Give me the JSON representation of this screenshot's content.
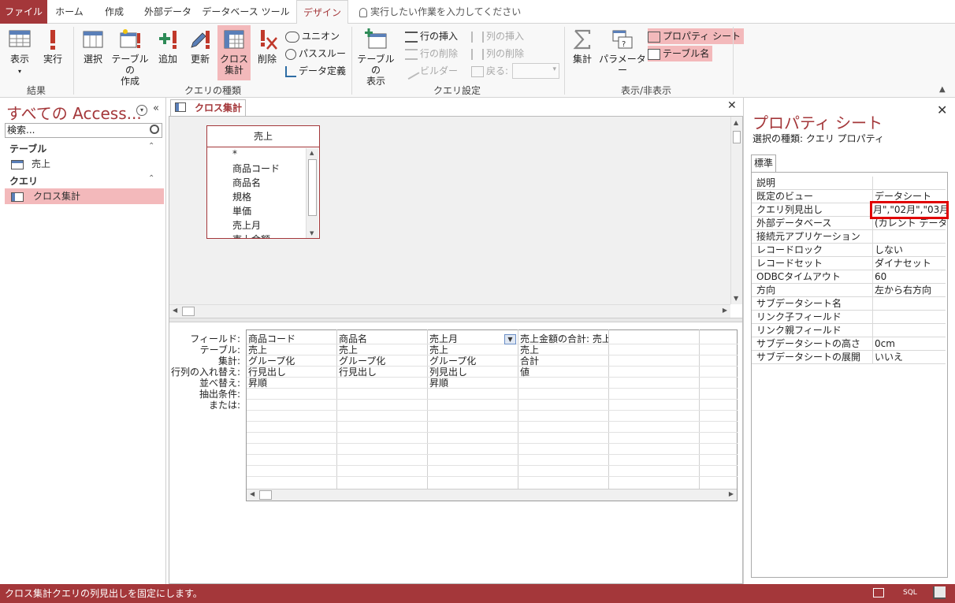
{
  "tabs": {
    "file": "ファイル",
    "home": "ホーム",
    "create": "作成",
    "external": "外部データ",
    "dbtools": "データベース ツール",
    "design": "デザイン",
    "tellme": "実行したい作業を入力してください"
  },
  "ribbon": {
    "results": {
      "label": "結果",
      "view": "表示",
      "run": "実行"
    },
    "querytype": {
      "label": "クエリの種類",
      "select": "選択",
      "maketable_1": "テーブルの",
      "maketable_2": "作成",
      "append": "追加",
      "update": "更新",
      "crosstab_1": "クロス",
      "crosstab_2": "集計",
      "delete": "削除",
      "union": "ユニオン",
      "passthrough": "パススルー",
      "datadef": "データ定義"
    },
    "setup": {
      "label": "クエリ設定",
      "showtable_1": "テーブルの",
      "showtable_2": "表示",
      "insert_rows": "行の挿入",
      "delete_rows": "行の削除",
      "builder": "ビルダー",
      "insert_cols": "列の挿入",
      "delete_cols": "列の削除",
      "return": "戻る:"
    },
    "showhide": {
      "label": "表示/非表示",
      "totals": "集計",
      "params": "パラメーター",
      "propsheet": "プロパティ シート",
      "tablenames": "テーブル名"
    }
  },
  "nav": {
    "title": "すべての Access...",
    "search_placeholder": "検索...",
    "section_tables": "テーブル",
    "table_item": "売上",
    "section_queries": "クエリ",
    "query_item": "クロス集計"
  },
  "document": {
    "tab_label": "クロス集計",
    "table_name": "売上",
    "fields": [
      "*",
      "商品コード",
      "商品名",
      "規格",
      "単価",
      "売上月",
      "売上金額"
    ],
    "row_labels": [
      "フィールド:",
      "テーブル:",
      "集計:",
      "行列の入れ替え:",
      "並べ替え:",
      "抽出条件:",
      "または:"
    ],
    "columns": [
      {
        "field": "商品コード",
        "table": "売上",
        "total": "グループ化",
        "crosstab": "行見出し",
        "sort": "昇順"
      },
      {
        "field": "商品名",
        "table": "売上",
        "total": "グループ化",
        "crosstab": "行見出し",
        "sort": ""
      },
      {
        "field": "売上月",
        "table": "売上",
        "total": "グループ化",
        "crosstab": "列見出し",
        "sort": "昇順"
      },
      {
        "field": "売上金額の合計: 売上",
        "table": "売上",
        "total": "合計",
        "crosstab": "値",
        "sort": ""
      }
    ]
  },
  "property_sheet": {
    "title": "プロパティ シート",
    "selection_type": "選択の種類: クエリ プロパティ",
    "tab": "標準",
    "rows": [
      {
        "name": "説明",
        "value": ""
      },
      {
        "name": "既定のビュー",
        "value": "データシート"
      },
      {
        "name": "クエリ列見出し",
        "value": ""
      },
      {
        "name": "外部データベース",
        "value": "(カレント データベース)"
      },
      {
        "name": "接続元アプリケーション",
        "value": ""
      },
      {
        "name": "レコードロック",
        "value": "しない"
      },
      {
        "name": "レコードセット",
        "value": "ダイナセット"
      },
      {
        "name": "ODBCタイムアウト",
        "value": "60"
      },
      {
        "name": "方向",
        "value": "左から右方向"
      },
      {
        "name": "サブデータシート名",
        "value": ""
      },
      {
        "name": "リンク子フィールド",
        "value": ""
      },
      {
        "name": "リンク親フィールド",
        "value": ""
      },
      {
        "name": "サブデータシートの高さ",
        "value": "0cm"
      },
      {
        "name": "サブデータシートの展開",
        "value": "いいえ"
      }
    ],
    "highlighted_value": "月\",\"02月\",\"03月\""
  },
  "status": {
    "message": "クロス集計クエリの列見出しを固定にします。",
    "sql": "SQL"
  },
  "colors": {
    "accent": "#a4373a",
    "highlight": "#f3b9bb",
    "redbox": "#e00000"
  }
}
